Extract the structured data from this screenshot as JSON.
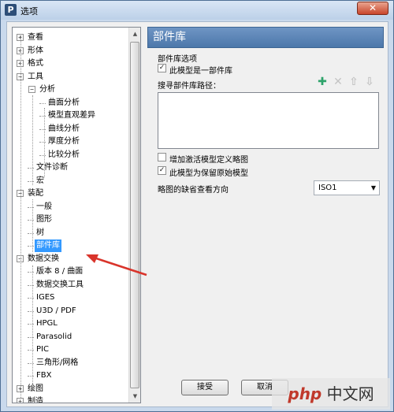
{
  "window": {
    "title": "选项",
    "app_icon": "P",
    "close_label": "✕"
  },
  "tree": {
    "items": [
      {
        "label": "查看",
        "level": 0,
        "expander": "+"
      },
      {
        "label": "形体",
        "level": 0,
        "expander": "+"
      },
      {
        "label": "格式",
        "level": 0,
        "expander": "+"
      },
      {
        "label": "工具",
        "level": 0,
        "expander": "−"
      },
      {
        "label": "分析",
        "level": 1,
        "expander": "−"
      },
      {
        "label": "曲面分析",
        "level": 2
      },
      {
        "label": "模型直观差异",
        "level": 2
      },
      {
        "label": "曲线分析",
        "level": 2
      },
      {
        "label": "厚度分析",
        "level": 2
      },
      {
        "label": "比较分析",
        "level": 2
      },
      {
        "label": "文件诊断",
        "level": 1
      },
      {
        "label": "宏",
        "level": 1
      },
      {
        "label": "装配",
        "level": 0,
        "expander": "−"
      },
      {
        "label": "一般",
        "level": 1
      },
      {
        "label": "图形",
        "level": 1
      },
      {
        "label": "树",
        "level": 1
      },
      {
        "label": "部件库",
        "level": 1,
        "selected": true
      },
      {
        "label": "数据交换",
        "level": 0,
        "expander": "−"
      },
      {
        "label": "版本 8 / 曲面",
        "level": 1
      },
      {
        "label": "数据交换工具",
        "level": 1
      },
      {
        "label": "IGES",
        "level": 1
      },
      {
        "label": "U3D / PDF",
        "level": 1
      },
      {
        "label": "HPGL",
        "level": 1
      },
      {
        "label": "Parasolid",
        "level": 1
      },
      {
        "label": "PIC",
        "level": 1
      },
      {
        "label": "三角形/网格",
        "level": 1
      },
      {
        "label": "FBX",
        "level": 1
      },
      {
        "label": "绘图",
        "level": 0,
        "expander": "+"
      },
      {
        "label": "制造",
        "level": 0,
        "expander": "+"
      }
    ],
    "scroll_up": "▲",
    "scroll_down": "▼"
  },
  "panel": {
    "header": "部件库",
    "options_title": "部件库选项",
    "is_library": {
      "label": "此模型是一部件库",
      "checked": true,
      "mark": "✓"
    },
    "search_path_label": "搜寻部件库路径：",
    "tools": [
      {
        "icon": "add-icon",
        "glyph": "✚",
        "color": "#2ea36b"
      },
      {
        "icon": "delete-icon",
        "glyph": "✕",
        "color": "#c4c4c4"
      },
      {
        "icon": "move-up-icon",
        "glyph": "⇧",
        "color": "#c4c4c4"
      },
      {
        "icon": "move-down-icon",
        "glyph": "⇩",
        "color": "#c4c4c4"
      }
    ],
    "add_sketch": {
      "label": "增加激活模型定义略图",
      "checked": false,
      "mark": ""
    },
    "keep_original": {
      "label": "此模型为保留原始模型",
      "checked": true,
      "mark": "✓"
    },
    "default_view_label": "略图的缺省查看方向",
    "default_view_value": "ISO1",
    "caret": "▼",
    "accept_label": "接受",
    "cancel_label": "取消"
  },
  "watermark": {
    "brand": "php",
    "site": "中文网"
  }
}
